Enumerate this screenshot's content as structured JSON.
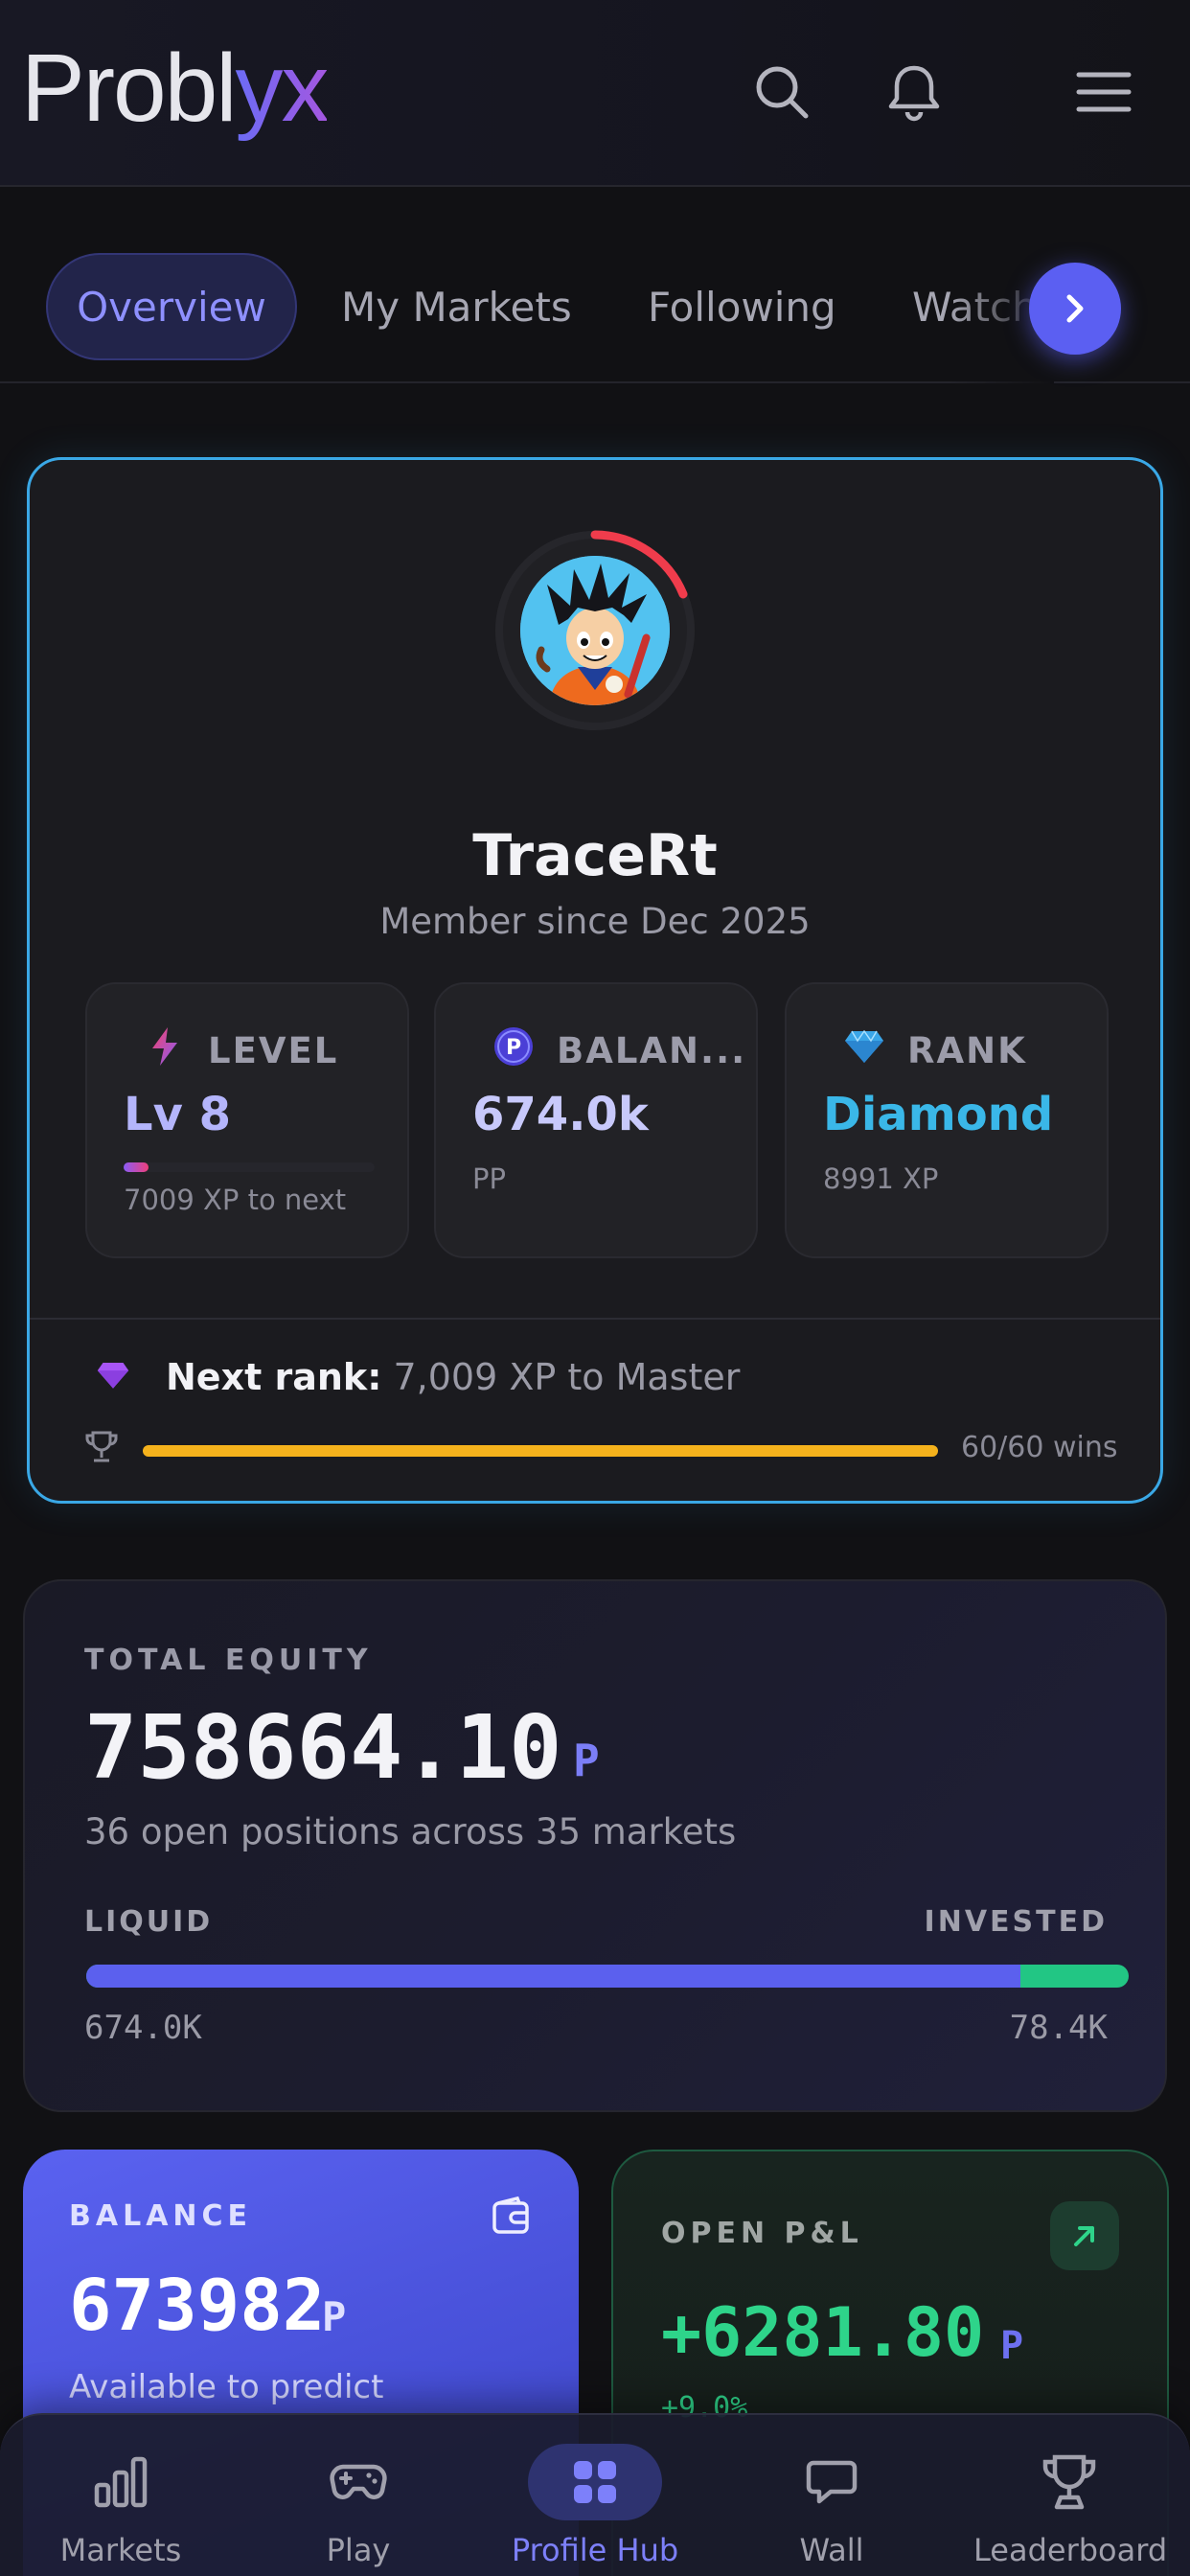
{
  "app": {
    "logo_main": "Probl",
    "logo_accent": "yx"
  },
  "header": {
    "icons": [
      "search-icon",
      "bell-icon",
      "menu-icon"
    ]
  },
  "tabs": [
    {
      "label": "Overview",
      "active": true
    },
    {
      "label": "My Markets",
      "active": false
    },
    {
      "label": "Following",
      "active": false
    },
    {
      "label": "Watch",
      "active": false
    }
  ],
  "profile": {
    "username": "TraceRt",
    "member_since": "Member since Dec 2025",
    "stats": [
      {
        "label": "LEVEL",
        "value": "Lv 8",
        "sub": "7009 XP to next",
        "icon": "lightning-icon",
        "progress": 0.1
      },
      {
        "label": "BALAN...",
        "value": "674.0k",
        "sub": "PP",
        "icon": "points-icon"
      },
      {
        "label": "RANK",
        "value": "Diamond",
        "sub": "8991 XP",
        "icon": "diamond-icon"
      }
    ],
    "next_rank_label": "Next rank:",
    "next_rank_text": " 7,009 XP to Master",
    "wins_text": "60/60 wins",
    "wins_progress": 1.0
  },
  "equity": {
    "label": "TOTAL EQUITY",
    "value": "758664.10",
    "unit": "P",
    "sub": "36 open positions across 35 markets",
    "liquid_label": "LIQUID",
    "invested_label": "INVESTED",
    "liquid_value": "674.0K",
    "invested_value": "78.4K",
    "liquid_fraction": 0.896
  },
  "balance_card": {
    "label": "BALANCE",
    "value": "673982",
    "unit": "P",
    "sub": "Available to predict"
  },
  "pnl_card": {
    "label": "OPEN P&L",
    "value": "+6281.80",
    "unit": "P",
    "pct": "+9.0%"
  },
  "nav": [
    {
      "label": "Markets",
      "icon": "bar-chart-icon",
      "active": false
    },
    {
      "label": "Play",
      "icon": "gamepad-icon",
      "active": false
    },
    {
      "label": "Profile Hub",
      "icon": "grid-icon",
      "active": true
    },
    {
      "label": "Wall",
      "icon": "chat-icon",
      "active": false
    },
    {
      "label": "Leaderboard",
      "icon": "trophy-icon",
      "active": false
    }
  ],
  "colors": {
    "accent": "#5b5ff2",
    "rank": "#3ab7e8",
    "gain": "#2ed48a",
    "xp_bar": "#f5b21c"
  }
}
